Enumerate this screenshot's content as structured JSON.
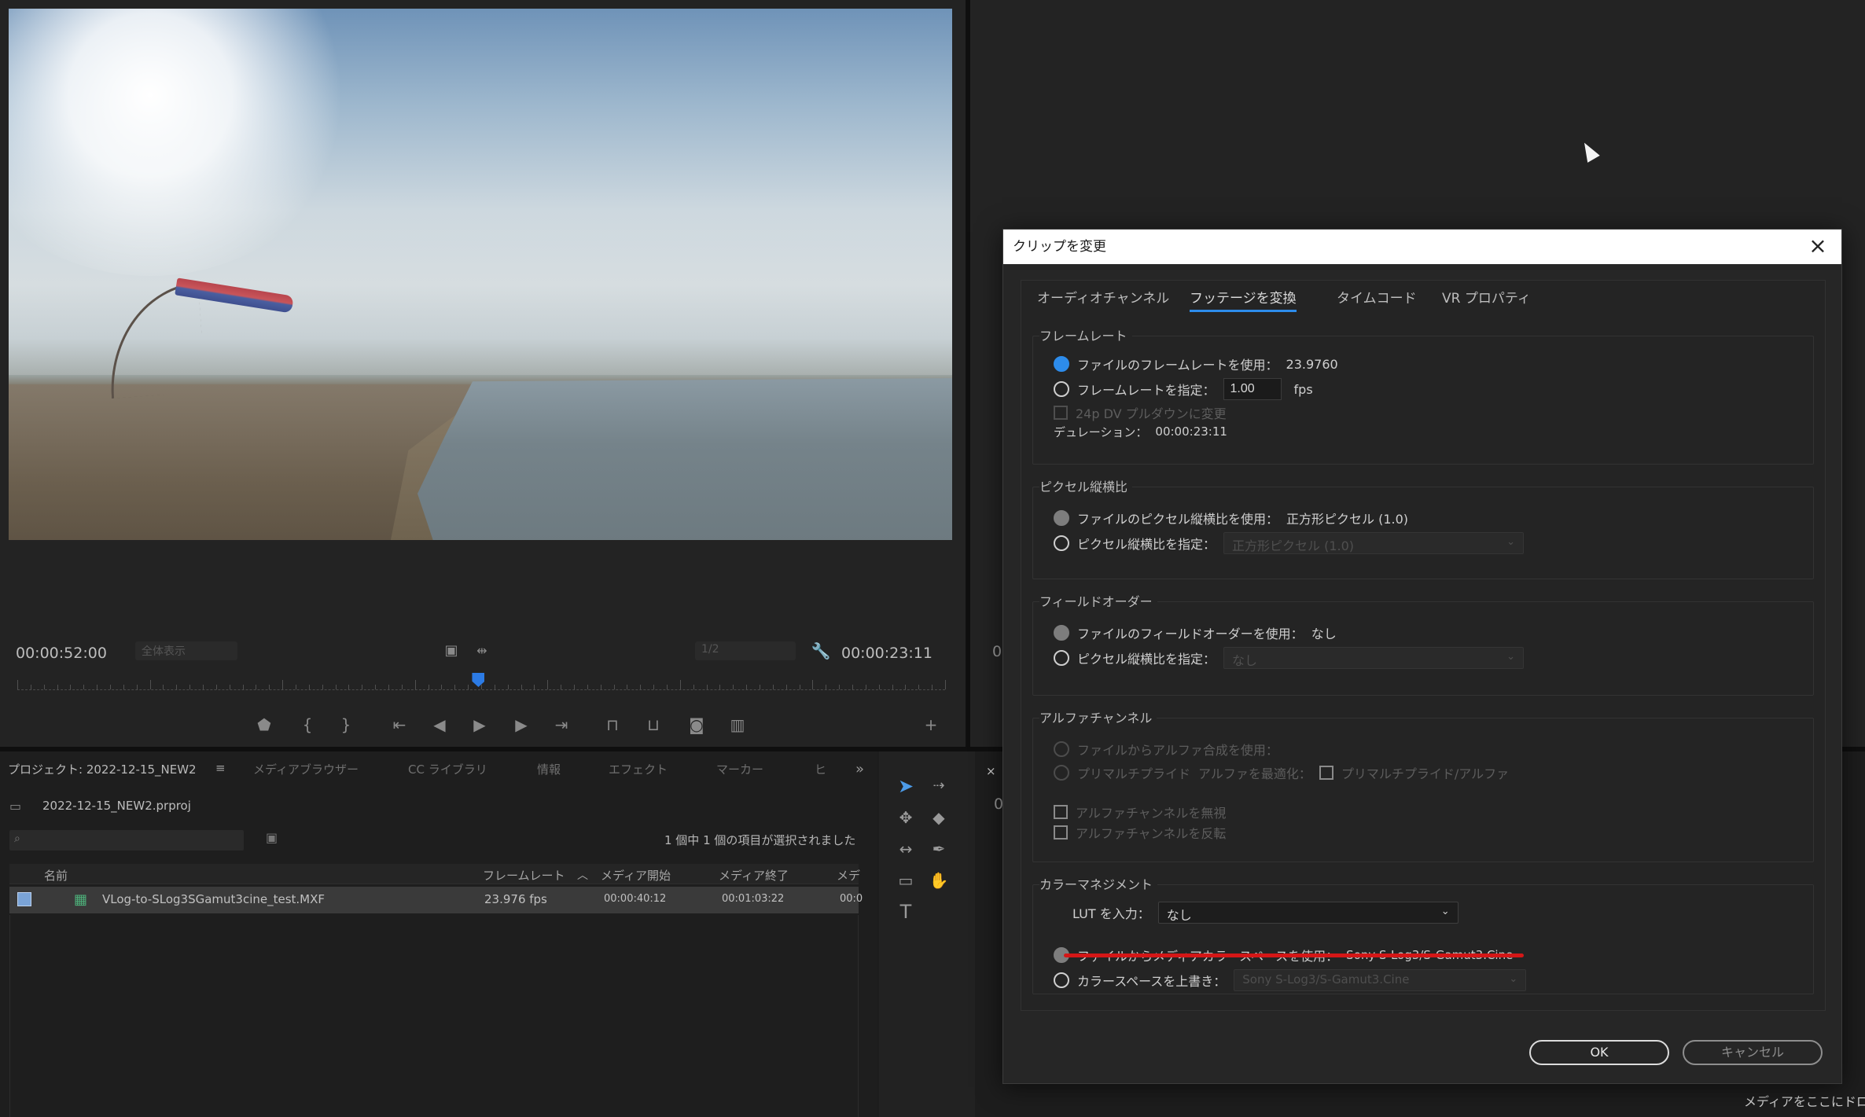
{
  "monitor": {
    "timecode_left": "00:00:52:00",
    "zoom_select": "全体表示",
    "resolution_select": "1/2",
    "timecode_right": "00:00:23:11",
    "playhead_fraction": 0.497
  },
  "project_panel": {
    "tabs": [
      "プロジェクト: 2022-12-15_NEW2",
      "メディアブラウザー",
      "CC ライブラリ",
      "情報",
      "エフェクト",
      "マーカー",
      "ヒ"
    ],
    "project_file": "2022-12-15_NEW2.prproj",
    "selection_status": "1 個中 1 個の項目が選択されました",
    "columns": [
      "名前",
      "フレームレート",
      "メディア開始",
      "メディア終了",
      "メデ"
    ],
    "rows": [
      {
        "name": "VLog-to-SLog3SGamut3cine_test.MXF",
        "frame_rate": "23.976 fps",
        "media_start": "00:00:40:12",
        "media_end": "00:01:03:22",
        "extra": "00:0"
      }
    ]
  },
  "dialog": {
    "title": "クリップを変更",
    "tabs": [
      "オーディオチャンネル",
      "フッテージを変換",
      "タイムコード",
      "VR プロパティ"
    ],
    "active_tab_index": 1,
    "frame_rate": {
      "label": "フレームレート",
      "use_file_label": "ファイルのフレームレートを使用：",
      "use_file_value": "23.9760",
      "specify_label": "フレームレートを指定：",
      "specify_value": "1.00",
      "fps": "fps",
      "pulldown_label": "24p DV プルダウンに変更",
      "duration_label": "デュレーション：",
      "duration_value": "00:00:23:11"
    },
    "pixel_aspect": {
      "label": "ピクセル縦横比",
      "use_file_label": "ファイルのピクセル縦横比を使用：",
      "use_file_value": "正方形ピクセル (1.0)",
      "specify_label": "ピクセル縦横比を指定：",
      "specify_value": "正方形ピクセル (1.0)"
    },
    "field_order": {
      "label": "フィールドオーダー",
      "use_file_label": "ファイルのフィールドオーダーを使用：",
      "use_file_value": "なし",
      "specify_label": "ピクセル縦横比を指定：",
      "specify_value": "なし"
    },
    "alpha": {
      "label": "アルファチャンネル",
      "use_file_label": "ファイルからアルファ合成を使用：",
      "premult_label": "プリマルチプライド",
      "premult_label2": "アルファを最適化：",
      "premult_check": "プリマルチプライド/アルファ",
      "ignore_label": "アルファチャンネルを無視",
      "invert_label": "アルファチャンネルを反転"
    },
    "color": {
      "label": "カラーマネジメント",
      "lut_label": "LUT を入力：",
      "lut_value": "なし",
      "use_media_label": "ファイルからメディアカラースペースを使用：",
      "use_media_value": "Sony S-Log3/S-Gamut3.Cine",
      "override_label": "カラースペースを上書き：",
      "override_value": "Sony S-Log3/S-Gamut3.Cine"
    },
    "ok_label": "OK",
    "cancel_label": "キャンセル"
  },
  "timeline_drop_hint": "メディアをここにドロ",
  "side_char_1": "0",
  "side_char_2": "0",
  "colors": {
    "accent": "#2d8ceb",
    "highlight_line": "#d41717"
  }
}
